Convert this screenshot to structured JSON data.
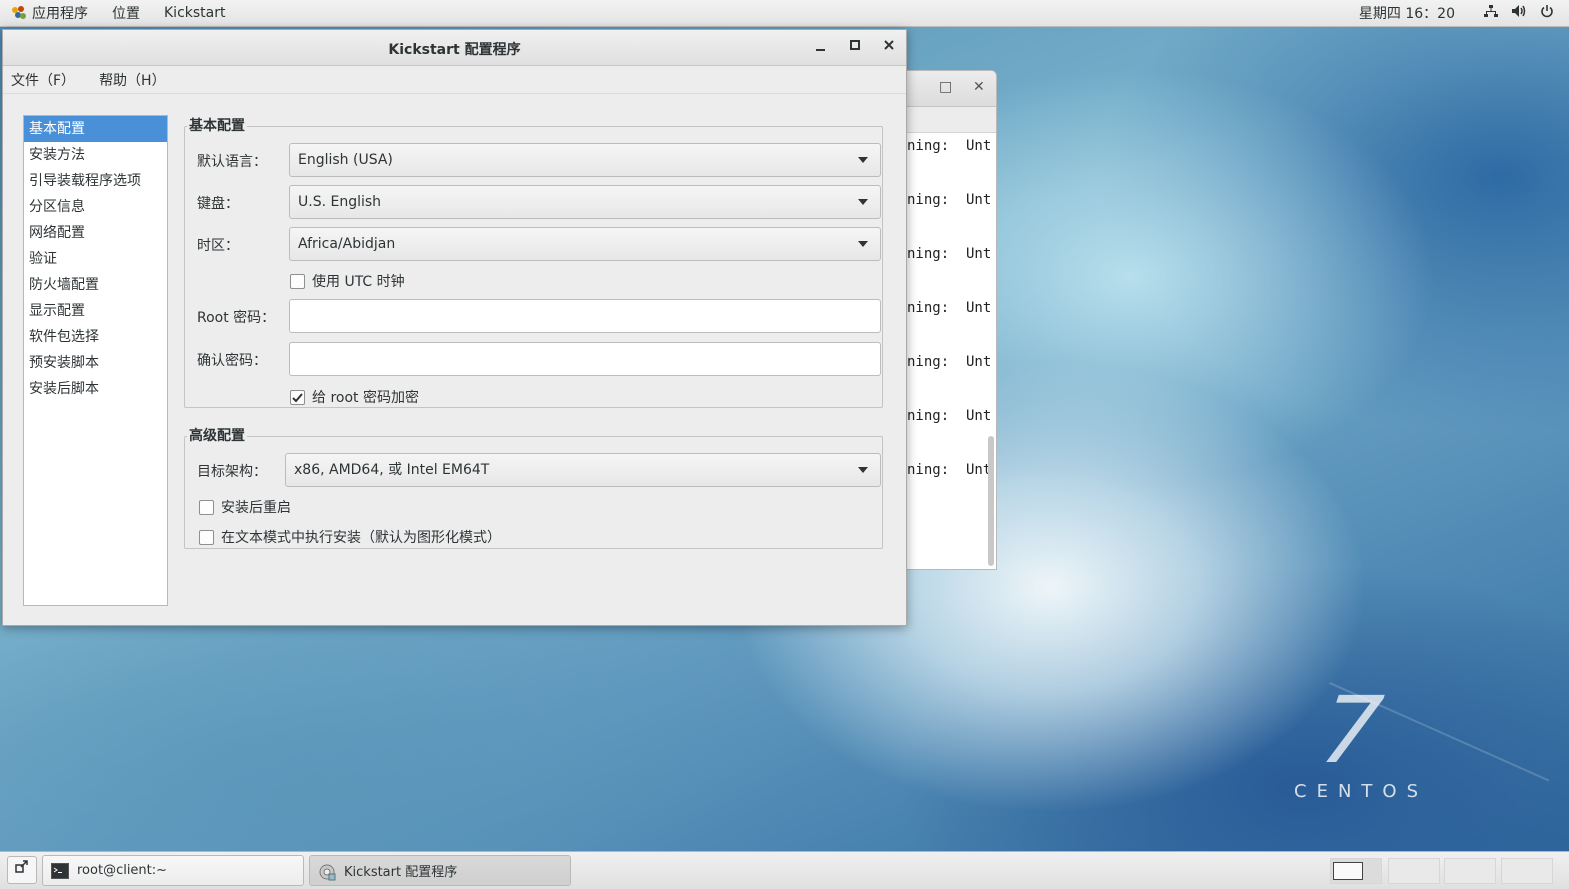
{
  "topbar": {
    "apps_label": "应用程序",
    "places_label": "位置",
    "active_app_label": "Kickstart",
    "clock": "星期四 16：20",
    "tray": {
      "network_icon": "network-icon",
      "volume_icon": "volume-icon",
      "power_icon": "power-icon"
    }
  },
  "terminal": {
    "lines": [
      "ning:  Unt",
      "ning:  Unt",
      "ning:  Unt",
      "ning:  Unt",
      "ning:  Unt",
      "ning:  Unt",
      "ning:  Unt"
    ]
  },
  "window": {
    "title": "Kickstart 配置程序",
    "minimize": "_",
    "maximize": "□",
    "close": "×"
  },
  "menubar": {
    "file": "文件（F）",
    "help": "帮助（H）"
  },
  "sidebar": {
    "items": [
      {
        "label": "基本配置"
      },
      {
        "label": "安装方法"
      },
      {
        "label": "引导装载程序选项"
      },
      {
        "label": "分区信息"
      },
      {
        "label": "网络配置"
      },
      {
        "label": "验证"
      },
      {
        "label": "防火墙配置"
      },
      {
        "label": "显示配置"
      },
      {
        "label": "软件包选择"
      },
      {
        "label": "预安装脚本"
      },
      {
        "label": "安装后脚本"
      }
    ]
  },
  "basic": {
    "title": "基本配置",
    "language_label": "默认语言：",
    "language_value": "English (USA)",
    "keyboard_label": "键盘：",
    "keyboard_value": "U.S. English",
    "timezone_label": "时区：",
    "timezone_value": "Africa/Abidjan",
    "utc_label": "使用  UTC 时钟",
    "utc_checked": false,
    "root_label": "Root 密码：",
    "root_value": "",
    "confirm_label": "确认密码：",
    "confirm_value": "",
    "encrypt_label": "给  root 密码加密",
    "encrypt_checked": true
  },
  "advanced": {
    "title": "高级配置",
    "arch_label": "目标架构：",
    "arch_value": "x86, AMD64, 或  Intel EM64T",
    "reboot_label": "安装后重启",
    "reboot_checked": false,
    "text_mode_label": "在文本模式中执行安装（默认为图形化模式）",
    "text_mode_checked": false
  },
  "taskbar": {
    "terminal_task": "root@client:~",
    "kickstart_task": "Kickstart 配置程序"
  },
  "wallpaper": {
    "version": "7",
    "brand": "CENTOS"
  },
  "colors": {
    "selection": "#4a90d9",
    "window_bg": "#ededed"
  }
}
